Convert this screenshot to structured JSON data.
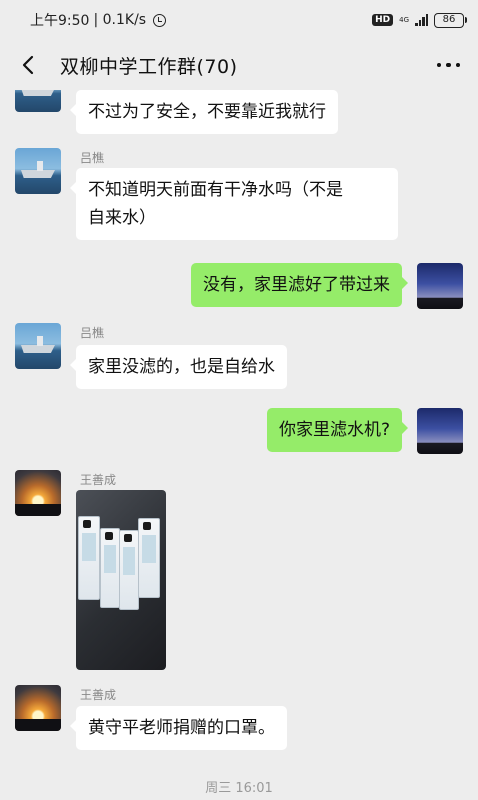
{
  "status_bar": {
    "time": "上午9:50",
    "speed": "| 0.1K/s",
    "hd": "HD",
    "network": "4G",
    "battery": "86"
  },
  "header": {
    "title": "双柳中学工作群(70)"
  },
  "messages": [
    {
      "side": "left",
      "sender": "",
      "text": "不过为了安全，不要靠近我就行"
    },
    {
      "side": "left",
      "sender": "吕樵",
      "line1": "不知道明天前面有干净水吗（不是",
      "line2": "自来水）"
    },
    {
      "side": "right",
      "text": "没有，家里滤好了带过来"
    },
    {
      "side": "left",
      "sender": "吕樵",
      "text": "家里没滤的，也是自给水"
    },
    {
      "side": "right",
      "text": "你家里滤水机?"
    },
    {
      "side": "left",
      "sender": "王善成",
      "type": "image"
    },
    {
      "side": "left",
      "sender": "王善成",
      "text": "黄守平老师捐赠的口罩。"
    }
  ],
  "timestamp": "周三 16:01"
}
